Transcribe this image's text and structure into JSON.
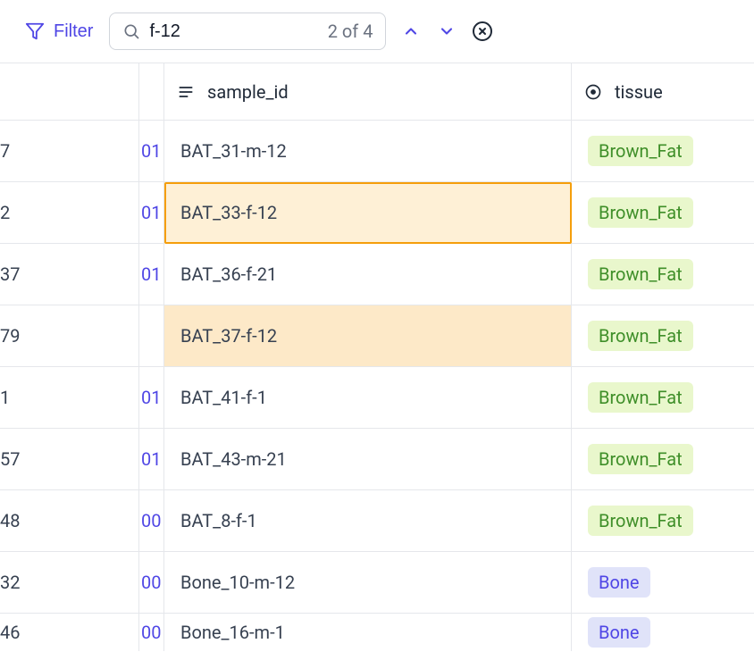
{
  "toolbar": {
    "filter_label": "Filter",
    "search_value": "f-12",
    "search_result_text": "2 of 4"
  },
  "columns": {
    "sample_id": "sample_id",
    "tissue": "tissue"
  },
  "rows": [
    {
      "c1": "7",
      "c2": "01",
      "sample_id": "BAT_31-m-12",
      "tissue": "Brown_Fat",
      "match": false,
      "current": false
    },
    {
      "c1": "2",
      "c2": "01",
      "sample_id": "BAT_33-f-12",
      "tissue": "Brown_Fat",
      "match": true,
      "current": true
    },
    {
      "c1": "37",
      "c2": "01",
      "sample_id": "BAT_36-f-21",
      "tissue": "Brown_Fat",
      "match": false,
      "current": false
    },
    {
      "c1": "79",
      "c2": "",
      "sample_id": "BAT_37-f-12",
      "tissue": "Brown_Fat",
      "match": true,
      "current": false
    },
    {
      "c1": "1",
      "c2": "01",
      "sample_id": "BAT_41-f-1",
      "tissue": "Brown_Fat",
      "match": false,
      "current": false
    },
    {
      "c1": "57",
      "c2": "01",
      "sample_id": "BAT_43-m-21",
      "tissue": "Brown_Fat",
      "match": false,
      "current": false
    },
    {
      "c1": "48",
      "c2": "00",
      "sample_id": "BAT_8-f-1",
      "tissue": "Brown_Fat",
      "match": false,
      "current": false
    },
    {
      "c1": "32",
      "c2": "00",
      "sample_id": "Bone_10-m-12",
      "tissue": "Bone",
      "match": false,
      "current": false
    },
    {
      "c1": "46",
      "c2": "00",
      "sample_id": "Bone_16-m-1",
      "tissue": "Bone",
      "match": false,
      "current": false
    }
  ]
}
